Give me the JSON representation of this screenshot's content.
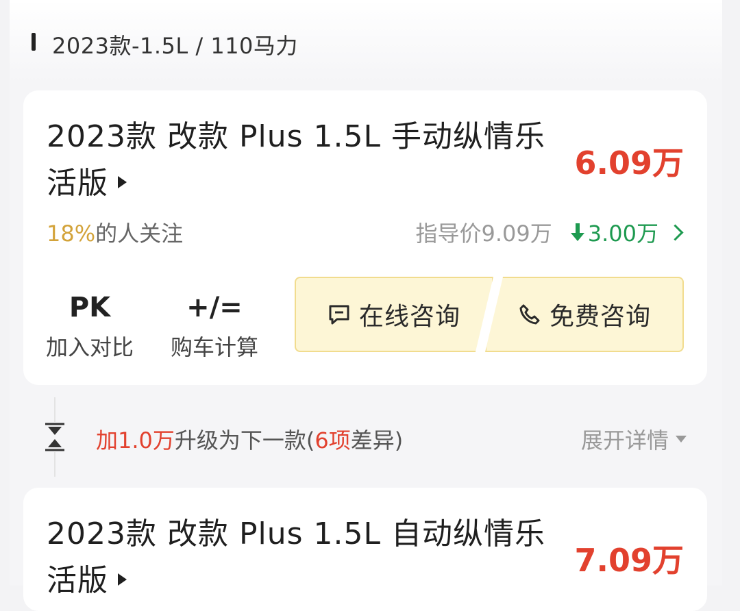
{
  "section": {
    "title": "2023款-1.5L / 110马力"
  },
  "card1": {
    "name": "2023款 改款 Plus 1.5L 手动纵情乐活版",
    "price": "6.09万",
    "attention_pct": "18%",
    "attention_text": "的人关注",
    "guide_price": "指导价9.09万",
    "drop": "3.00万"
  },
  "tools": {
    "pk_icon": "PK",
    "pk_label": "加入对比",
    "calc_icon": "+/=",
    "calc_label": "购车计算"
  },
  "consult": {
    "online": "在线咨询",
    "free": "免费咨询"
  },
  "upgrade": {
    "prefix": "加",
    "amount": "1.0万",
    "mid": "升级为下一款(",
    "count": "6",
    "unit": "项",
    "suffix": "差异)",
    "expand": "展开详情"
  },
  "card2": {
    "name": "2023款 改款 Plus 1.5L 自动纵情乐活版",
    "price": "7.09万"
  }
}
